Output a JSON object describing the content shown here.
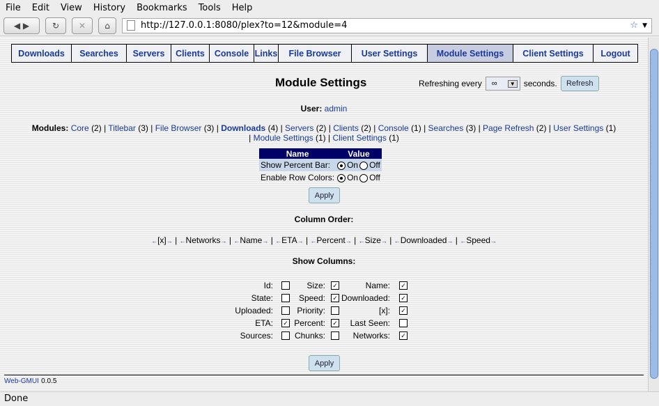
{
  "menu": [
    "File",
    "Edit",
    "View",
    "History",
    "Bookmarks",
    "Tools",
    "Help"
  ],
  "url": "http://127.0.0.1:8080/plex?to=12&module=4",
  "tabs": [
    "Downloads",
    "Searches",
    "Servers",
    "Clients",
    "Console",
    "Links",
    "File Browser",
    "User Settings",
    "Module Settings",
    "Client Settings",
    "Logout"
  ],
  "active_tab": "Module Settings",
  "page_title": "Module Settings",
  "refresh": {
    "prefix": "Refreshing every",
    "value": "∞",
    "suffix": "seconds.",
    "button": "Refresh"
  },
  "user": {
    "label": "User:",
    "name": "admin"
  },
  "modules": {
    "label": "Modules:",
    "items": [
      {
        "name": "Core",
        "count": "(2)"
      },
      {
        "name": "Titlebar",
        "count": "(3)"
      },
      {
        "name": "File Browser",
        "count": "(3)"
      },
      {
        "name": "Downloads",
        "count": "(4)"
      },
      {
        "name": "Servers",
        "count": "(2)"
      },
      {
        "name": "Clients",
        "count": "(2)"
      },
      {
        "name": "Console",
        "count": "(1)"
      },
      {
        "name": "Searches",
        "count": "(3)"
      },
      {
        "name": "Page Refresh",
        "count": "(2)"
      },
      {
        "name": "User Settings",
        "count": "(1)"
      },
      {
        "name": "Module Settings",
        "count": "(1)"
      },
      {
        "name": "Client Settings",
        "count": "(1)"
      }
    ]
  },
  "settings": {
    "headers": [
      "Name",
      "Value"
    ],
    "on": "On",
    "off": "Off",
    "rows": [
      {
        "name": "Show Percent Bar:",
        "value": "On"
      },
      {
        "name": "Enable Row Colors:",
        "value": "On"
      }
    ]
  },
  "apply": "Apply",
  "column_order": {
    "label": "Column Order:",
    "items": [
      "[x]",
      "Networks",
      "Name",
      "ETA",
      "Percent",
      "Size",
      "Downloaded",
      "Speed"
    ]
  },
  "show_columns": {
    "label": "Show Columns:",
    "rows": [
      [
        {
          "label": "Id:",
          "checked": false
        },
        {
          "label": "Size:",
          "checked": true
        },
        {
          "label": "Name:",
          "checked": true
        }
      ],
      [
        {
          "label": "State:",
          "checked": false
        },
        {
          "label": "Speed:",
          "checked": true
        },
        {
          "label": "Downloaded:",
          "checked": true
        }
      ],
      [
        {
          "label": "Uploaded:",
          "checked": false
        },
        {
          "label": "Priority:",
          "checked": false
        },
        {
          "label": "[x]:",
          "checked": true
        }
      ],
      [
        {
          "label": "ETA:",
          "checked": true
        },
        {
          "label": "Percent:",
          "checked": true
        },
        {
          "label": "Last Seen:",
          "checked": false
        }
      ],
      [
        {
          "label": "Sources:",
          "checked": false
        },
        {
          "label": "Chunks:",
          "checked": false
        },
        {
          "label": "Networks:",
          "checked": true
        }
      ]
    ]
  },
  "footer": {
    "link": "Web-GMUI",
    "version": "0.0.5"
  },
  "status": "Done"
}
